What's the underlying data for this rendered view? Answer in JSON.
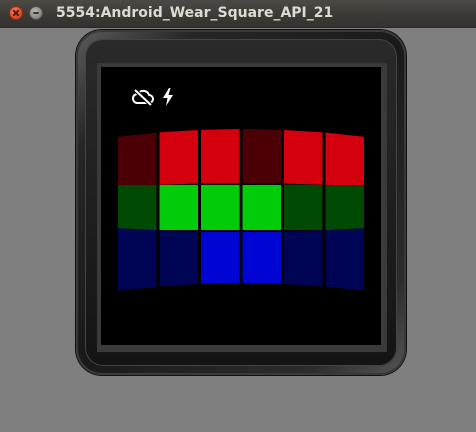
{
  "window": {
    "title": "5554:Android_Wear_Square_API_21"
  },
  "watch": {
    "status_icons": [
      "cloud-off-icon",
      "bolt-icon"
    ],
    "grid": {
      "rows": [
        {
          "name": "red",
          "cells": [
            "#4a0004",
            "#d4000d",
            "#d4000d",
            "#4a0004",
            "#d4000d",
            "#d4000d"
          ]
        },
        {
          "name": "green",
          "cells": [
            "#004a04",
            "#00cc0a",
            "#00cc0a",
            "#00cc0a",
            "#004a04",
            "#004a04"
          ]
        },
        {
          "name": "blue",
          "cells": [
            "#000454",
            "#000454",
            "#0005d4",
            "#0005d4",
            "#000454",
            "#000454"
          ]
        }
      ]
    }
  }
}
